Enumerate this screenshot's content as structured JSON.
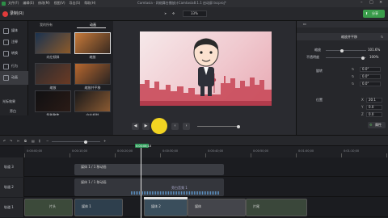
{
  "window": {
    "title": "Camtasia - 网络舞台播放计Camtasia8.1.1 启动屏.tscproj*"
  },
  "menu": [
    "文件(F)",
    "编辑(E)",
    "修改(M)",
    "视图(V)",
    "导出(S)",
    "帮助(H)"
  ],
  "toolbar": {
    "record_label": "录制(R)",
    "zoom": "33%",
    "share_label": "分享"
  },
  "nav": [
    "媒体",
    "注释",
    "转换",
    "行为",
    "动画",
    "光标效果",
    "旁白"
  ],
  "media": {
    "tabs": [
      "我的所有",
      "动画"
    ],
    "items": [
      "向左倾斜",
      "缩放",
      "缩放",
      "缩放并平移",
      "智能聚焦",
      "向右倾斜"
    ]
  },
  "props": {
    "tab": "缩放并平移",
    "labels": {
      "scale": "缩放",
      "opacity": "不透明度",
      "rotation": "旋转",
      "position": "位置"
    },
    "scale": "101.6%",
    "opacity": "100%",
    "rot": [
      "0.0°",
      "0.0°",
      "0.0°"
    ],
    "pos": [
      "20.1",
      "0.0",
      "0.0"
    ],
    "button": "属性"
  },
  "timeline": {
    "playhead": "0:00:06;10",
    "ruler": [
      "0:00:00;00",
      "0:00:10;00",
      "0:00:20;00",
      "0:00:30;00",
      "0:00:40;00",
      "0:00:50;00",
      "0:01:00;00",
      "0:01:10;00",
      "0:01:20;00"
    ],
    "tracks": [
      "轨道 3",
      "轨道 2",
      "轨道 1"
    ],
    "clips": {
      "t3": "媒体 1 / 1 移动画",
      "t2": "媒体 1 / 1 移动画",
      "t2b": "旁白音频 1",
      "t1a": "片头",
      "t1b": "媒体 1",
      "t1c": "媒体 2",
      "t1d": "媒体",
      "t1e": "片尾"
    }
  }
}
